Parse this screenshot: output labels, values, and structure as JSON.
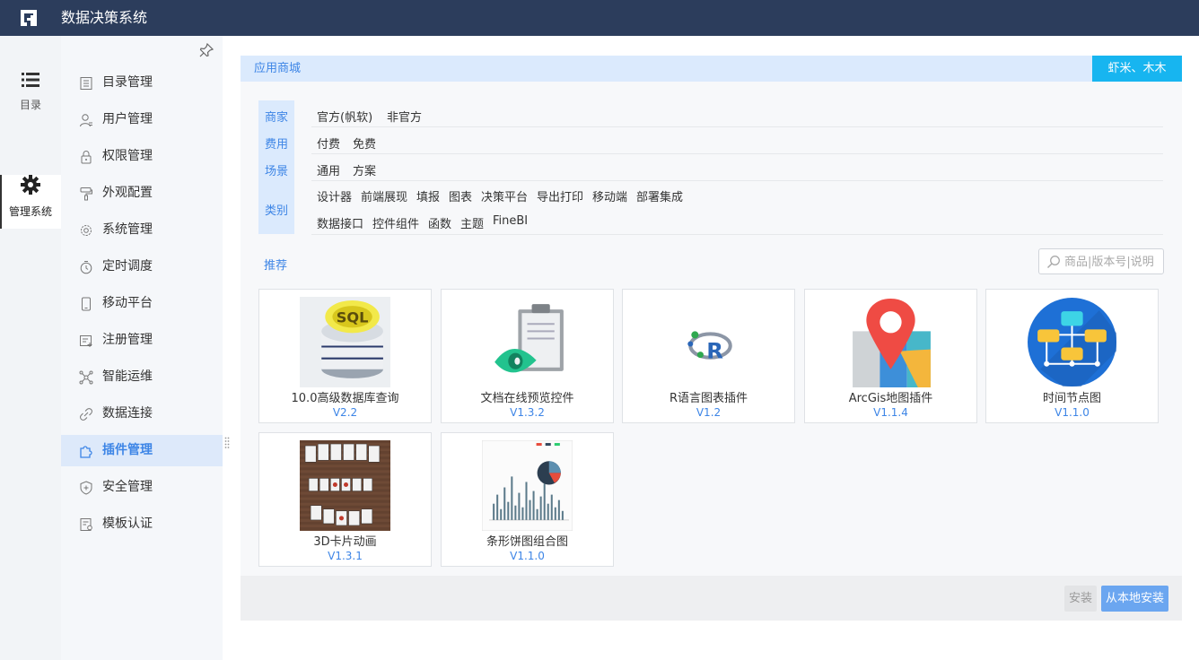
{
  "app": {
    "title": "数据决策系统"
  },
  "rail": [
    {
      "label": "目录",
      "icon": "list-icon"
    },
    {
      "label": "管理系统",
      "icon": "gear-icon",
      "active": true
    }
  ],
  "menu": [
    {
      "label": "目录管理",
      "icon": "catalog-icon"
    },
    {
      "label": "用户管理",
      "icon": "user-icon"
    },
    {
      "label": "权限管理",
      "icon": "lock-icon"
    },
    {
      "label": "外观配置",
      "icon": "paint-roller-icon"
    },
    {
      "label": "系统管理",
      "icon": "settings-icon"
    },
    {
      "label": "定时调度",
      "icon": "clock-icon"
    },
    {
      "label": "移动平台",
      "icon": "mobile-icon"
    },
    {
      "label": "注册管理",
      "icon": "register-icon"
    },
    {
      "label": "智能运维",
      "icon": "network-icon"
    },
    {
      "label": "数据连接",
      "icon": "link-icon"
    },
    {
      "label": "插件管理",
      "icon": "puzzle-icon",
      "active": true
    },
    {
      "label": "安全管理",
      "icon": "shield-icon"
    },
    {
      "label": "模板认证",
      "icon": "certificate-icon"
    }
  ],
  "tab": {
    "label": "应用商城",
    "user": "虾米、木木"
  },
  "filters": {
    "merchant": {
      "label": "商家",
      "options": [
        "官方(帆软)",
        "非官方"
      ]
    },
    "cost": {
      "label": "费用",
      "options": [
        "付费",
        "免费"
      ]
    },
    "scene": {
      "label": "场景",
      "options": [
        "通用",
        "方案"
      ]
    },
    "category": {
      "label": "类别",
      "row1": [
        "设计器",
        "前端展现",
        "填报",
        "图表",
        "决策平台",
        "导出打印",
        "移动端",
        "部署集成"
      ],
      "row2": [
        "数据接口",
        "控件组件",
        "函数",
        "主题",
        "FineBI"
      ]
    }
  },
  "recommend_label": "推荐",
  "search": {
    "placeholder": "商品|版本号|说明"
  },
  "plugins": [
    {
      "name": "10.0高级数据库查询",
      "version": "V2.2",
      "icon": "sql-database-icon",
      "thumb_text": "SQL"
    },
    {
      "name": "文档在线预览控件",
      "version": "V1.3.2",
      "icon": "clipboard-eye-icon"
    },
    {
      "name": "R语言图表插件",
      "version": "V1.2",
      "icon": "r-language-icon",
      "thumb_text": "R"
    },
    {
      "name": "ArcGis地图插件",
      "version": "V1.1.4",
      "icon": "map-pin-icon"
    },
    {
      "name": "时间节点图",
      "version": "V1.1.0",
      "icon": "hierarchy-icon"
    },
    {
      "name": "3D卡片动画",
      "version": "V1.3.1",
      "icon": "card-carousel-icon"
    },
    {
      "name": "条形饼图组合图",
      "version": "V1.1.0",
      "icon": "bar-pie-chart-icon"
    }
  ],
  "footer": {
    "install": "安装",
    "local_install": "从本地安装"
  },
  "colors": {
    "topbar": "#2c3d5c",
    "accent": "#3d85e6",
    "badge": "#17b5f0"
  }
}
